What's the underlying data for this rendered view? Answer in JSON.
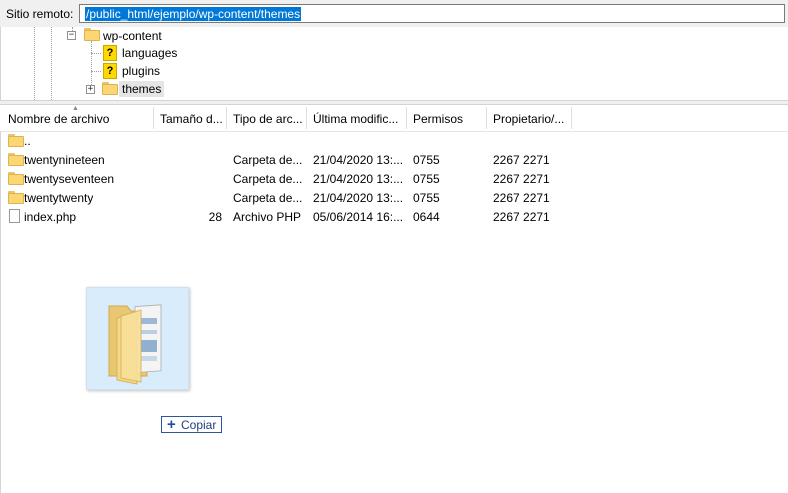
{
  "remote_site": {
    "label": "Sitio remoto:",
    "path": "/public_html/ejemplo/wp-content/themes"
  },
  "tree": {
    "items": [
      {
        "label": "wp-content",
        "icon": "folder-icon",
        "expander": "−"
      },
      {
        "label": "languages",
        "icon": "unknown-folder-icon"
      },
      {
        "label": "plugins",
        "icon": "unknown-folder-icon"
      },
      {
        "label": "themes",
        "icon": "folder-icon",
        "expander": "+",
        "selected": true
      }
    ]
  },
  "file_list": {
    "columns": [
      "Nombre de archivo",
      "Tamaño d...",
      "Tipo de arc...",
      "Última modific...",
      "Permisos",
      "Propietario/..."
    ],
    "rows": [
      {
        "name": "..",
        "size": "",
        "type": "",
        "modified": "",
        "permissions": "",
        "owner": "",
        "icon": "folder-icon"
      },
      {
        "name": "twentynineteen",
        "size": "",
        "type": "Carpeta de...",
        "modified": "21/04/2020 13:...",
        "permissions": "0755",
        "owner": "2267 2271",
        "icon": "folder-icon"
      },
      {
        "name": "twentyseventeen",
        "size": "",
        "type": "Carpeta de...",
        "modified": "21/04/2020 13:...",
        "permissions": "0755",
        "owner": "2267 2271",
        "icon": "folder-icon"
      },
      {
        "name": "twentytwenty",
        "size": "",
        "type": "Carpeta de...",
        "modified": "21/04/2020 13:...",
        "permissions": "0755",
        "owner": "2267 2271",
        "icon": "folder-icon"
      },
      {
        "name": "index.php",
        "size": "28",
        "type": "Archivo PHP",
        "modified": "05/06/2014 16:...",
        "permissions": "0644",
        "owner": "2267 2271",
        "icon": "file-icon"
      }
    ]
  },
  "drag": {
    "icon": "folder-stack-icon",
    "tooltip": "Copiar",
    "tooltip_icon": "plus-icon"
  },
  "colors": {
    "selection": "#0078d7",
    "folder": "#fbd774",
    "drag_bg": "#d9ecfb"
  }
}
